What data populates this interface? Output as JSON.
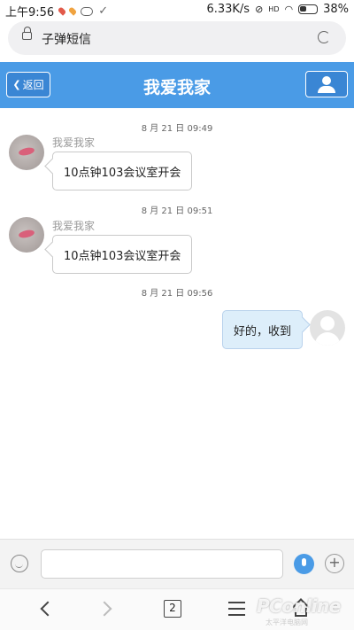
{
  "status_bar": {
    "time": "上午9:56",
    "speed": "6.33K/s",
    "network": "HD",
    "battery": "38%"
  },
  "browser": {
    "page_title": "子弹短信",
    "tab_count": "2"
  },
  "header": {
    "back_label": "返回",
    "title": "我爱我家"
  },
  "messages": [
    {
      "time": "8 月 21 日 09:49",
      "sender": "我爱我家",
      "text": "10点钟103会议室开会",
      "direction": "incoming"
    },
    {
      "time": "8 月 21 日 09:51",
      "sender": "我爱我家",
      "text": "10点钟103会议室开会",
      "direction": "incoming"
    },
    {
      "time": "8 月 21 日 09:56",
      "sender": "",
      "text": "好的，收到",
      "direction": "outgoing"
    }
  ],
  "input": {
    "value": "",
    "placeholder": ""
  },
  "watermark": {
    "brand": "PConline",
    "sub": "太平洋电脑网"
  },
  "colors": {
    "header_bg": "#4a9be6",
    "outgoing_bubble": "#ddeefa",
    "mic_button": "#4a9be6"
  },
  "icons": [
    "lock-icon",
    "reload-icon",
    "user-icon",
    "emoji-icon",
    "mic-icon",
    "plus-icon",
    "back-arrow-icon",
    "forward-arrow-icon",
    "tabs-icon",
    "menu-icon",
    "home-icon"
  ]
}
